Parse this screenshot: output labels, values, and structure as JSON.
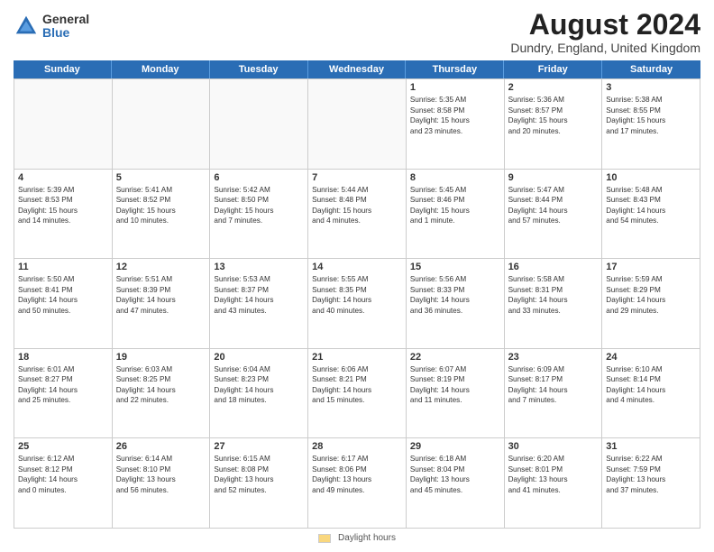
{
  "header": {
    "logo_general": "General",
    "logo_blue": "Blue",
    "month_year": "August 2024",
    "location": "Dundry, England, United Kingdom"
  },
  "days_of_week": [
    "Sunday",
    "Monday",
    "Tuesday",
    "Wednesday",
    "Thursday",
    "Friday",
    "Saturday"
  ],
  "weeks": [
    [
      {
        "day": "",
        "text": ""
      },
      {
        "day": "",
        "text": ""
      },
      {
        "day": "",
        "text": ""
      },
      {
        "day": "",
        "text": ""
      },
      {
        "day": "1",
        "text": "Sunrise: 5:35 AM\nSunset: 8:58 PM\nDaylight: 15 hours\nand 23 minutes."
      },
      {
        "day": "2",
        "text": "Sunrise: 5:36 AM\nSunset: 8:57 PM\nDaylight: 15 hours\nand 20 minutes."
      },
      {
        "day": "3",
        "text": "Sunrise: 5:38 AM\nSunset: 8:55 PM\nDaylight: 15 hours\nand 17 minutes."
      }
    ],
    [
      {
        "day": "4",
        "text": "Sunrise: 5:39 AM\nSunset: 8:53 PM\nDaylight: 15 hours\nand 14 minutes."
      },
      {
        "day": "5",
        "text": "Sunrise: 5:41 AM\nSunset: 8:52 PM\nDaylight: 15 hours\nand 10 minutes."
      },
      {
        "day": "6",
        "text": "Sunrise: 5:42 AM\nSunset: 8:50 PM\nDaylight: 15 hours\nand 7 minutes."
      },
      {
        "day": "7",
        "text": "Sunrise: 5:44 AM\nSunset: 8:48 PM\nDaylight: 15 hours\nand 4 minutes."
      },
      {
        "day": "8",
        "text": "Sunrise: 5:45 AM\nSunset: 8:46 PM\nDaylight: 15 hours\nand 1 minute."
      },
      {
        "day": "9",
        "text": "Sunrise: 5:47 AM\nSunset: 8:44 PM\nDaylight: 14 hours\nand 57 minutes."
      },
      {
        "day": "10",
        "text": "Sunrise: 5:48 AM\nSunset: 8:43 PM\nDaylight: 14 hours\nand 54 minutes."
      }
    ],
    [
      {
        "day": "11",
        "text": "Sunrise: 5:50 AM\nSunset: 8:41 PM\nDaylight: 14 hours\nand 50 minutes."
      },
      {
        "day": "12",
        "text": "Sunrise: 5:51 AM\nSunset: 8:39 PM\nDaylight: 14 hours\nand 47 minutes."
      },
      {
        "day": "13",
        "text": "Sunrise: 5:53 AM\nSunset: 8:37 PM\nDaylight: 14 hours\nand 43 minutes."
      },
      {
        "day": "14",
        "text": "Sunrise: 5:55 AM\nSunset: 8:35 PM\nDaylight: 14 hours\nand 40 minutes."
      },
      {
        "day": "15",
        "text": "Sunrise: 5:56 AM\nSunset: 8:33 PM\nDaylight: 14 hours\nand 36 minutes."
      },
      {
        "day": "16",
        "text": "Sunrise: 5:58 AM\nSunset: 8:31 PM\nDaylight: 14 hours\nand 33 minutes."
      },
      {
        "day": "17",
        "text": "Sunrise: 5:59 AM\nSunset: 8:29 PM\nDaylight: 14 hours\nand 29 minutes."
      }
    ],
    [
      {
        "day": "18",
        "text": "Sunrise: 6:01 AM\nSunset: 8:27 PM\nDaylight: 14 hours\nand 25 minutes."
      },
      {
        "day": "19",
        "text": "Sunrise: 6:03 AM\nSunset: 8:25 PM\nDaylight: 14 hours\nand 22 minutes."
      },
      {
        "day": "20",
        "text": "Sunrise: 6:04 AM\nSunset: 8:23 PM\nDaylight: 14 hours\nand 18 minutes."
      },
      {
        "day": "21",
        "text": "Sunrise: 6:06 AM\nSunset: 8:21 PM\nDaylight: 14 hours\nand 15 minutes."
      },
      {
        "day": "22",
        "text": "Sunrise: 6:07 AM\nSunset: 8:19 PM\nDaylight: 14 hours\nand 11 minutes."
      },
      {
        "day": "23",
        "text": "Sunrise: 6:09 AM\nSunset: 8:17 PM\nDaylight: 14 hours\nand 7 minutes."
      },
      {
        "day": "24",
        "text": "Sunrise: 6:10 AM\nSunset: 8:14 PM\nDaylight: 14 hours\nand 4 minutes."
      }
    ],
    [
      {
        "day": "25",
        "text": "Sunrise: 6:12 AM\nSunset: 8:12 PM\nDaylight: 14 hours\nand 0 minutes."
      },
      {
        "day": "26",
        "text": "Sunrise: 6:14 AM\nSunset: 8:10 PM\nDaylight: 13 hours\nand 56 minutes."
      },
      {
        "day": "27",
        "text": "Sunrise: 6:15 AM\nSunset: 8:08 PM\nDaylight: 13 hours\nand 52 minutes."
      },
      {
        "day": "28",
        "text": "Sunrise: 6:17 AM\nSunset: 8:06 PM\nDaylight: 13 hours\nand 49 minutes."
      },
      {
        "day": "29",
        "text": "Sunrise: 6:18 AM\nSunset: 8:04 PM\nDaylight: 13 hours\nand 45 minutes."
      },
      {
        "day": "30",
        "text": "Sunrise: 6:20 AM\nSunset: 8:01 PM\nDaylight: 13 hours\nand 41 minutes."
      },
      {
        "day": "31",
        "text": "Sunrise: 6:22 AM\nSunset: 7:59 PM\nDaylight: 13 hours\nand 37 minutes."
      }
    ]
  ],
  "legend": {
    "box_label": "Daylight hours"
  }
}
